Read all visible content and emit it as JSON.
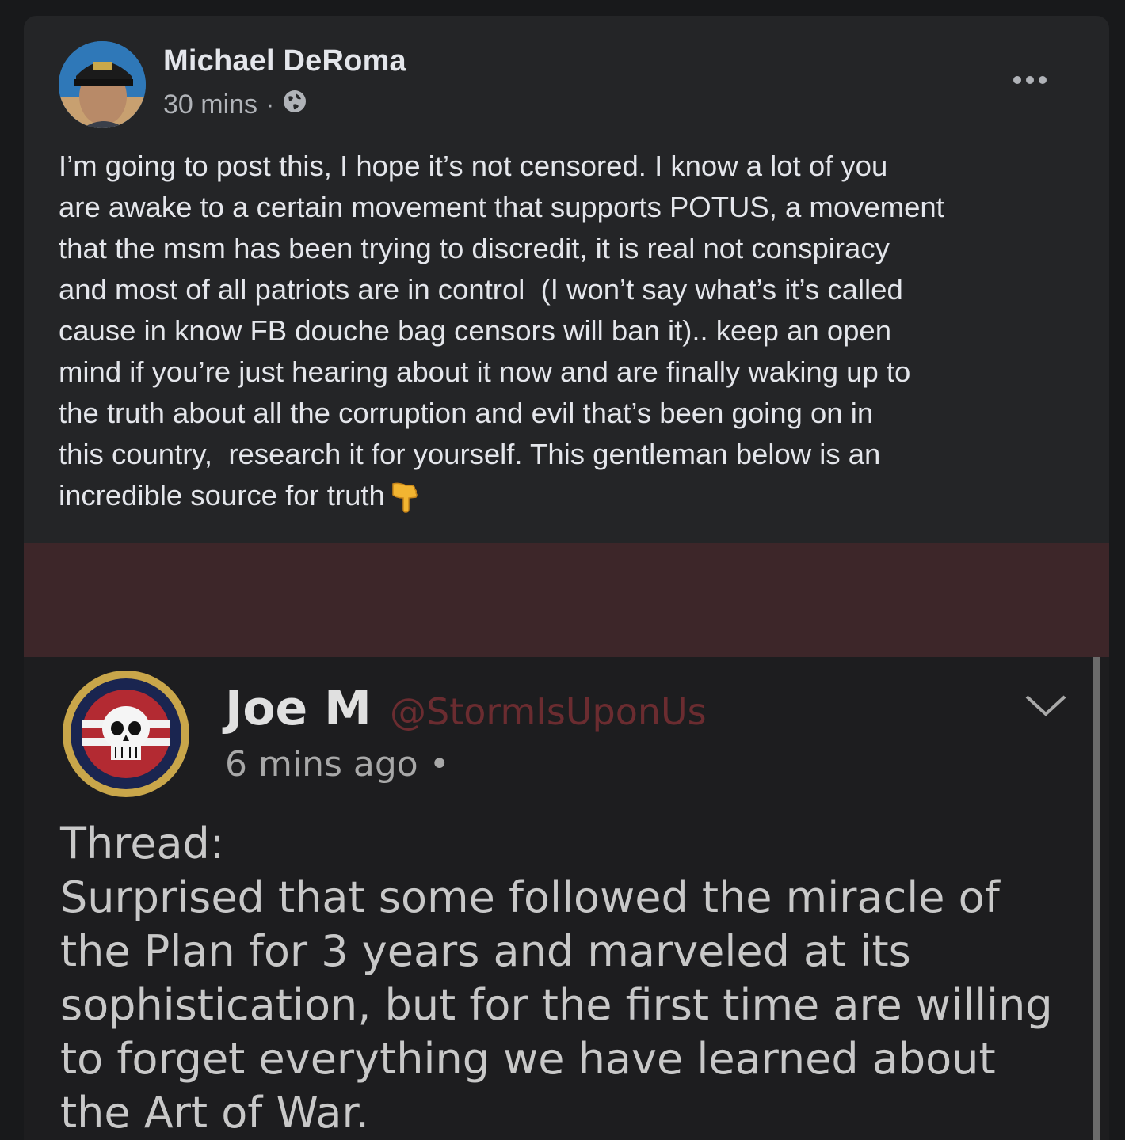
{
  "post": {
    "author": "Michael DeRoma",
    "time": "30 mins",
    "separator": "·",
    "visibility_icon": "globe-icon",
    "more_icon": "more-horizontal-icon",
    "text": "I’m going to post this, I hope it’s not censored. I know a lot of you\nare awake to a certain movement that supports POTUS, a movement\nthat the msm has been trying to discredit, it is real not conspiracy\nand most of all patriots are in control  (I won’t say what’s it’s called\ncause in know FB douche bag censors will ban it).. keep an open\nmind if you’re just hearing about it now and are finally waking up to\nthe truth about all the corruption and evil that’s been going on in\nthis country,  research it for yourself. This gentleman below is an\nincredible source for truth",
    "emoji": "pointing-down-hand-icon"
  },
  "colors": {
    "card_bg": "#242527",
    "page_bg": "#18191b",
    "banner": "#3d2629",
    "embed_bg": "#1d1d1f",
    "handle": "#6b2c30"
  },
  "embed": {
    "name": "Joe M",
    "handle": "@StormIsUponUs",
    "time": "6 mins ago",
    "bullet": "•",
    "chevron_icon": "chevron-down-icon",
    "thread_label": "Thread:",
    "body": "Surprised that some followed the miracle of\nthe Plan for 3 years and marveled at its\nsophistication, but for the first time are willing\nto forget everything we have learned about\nthe Art of War."
  }
}
